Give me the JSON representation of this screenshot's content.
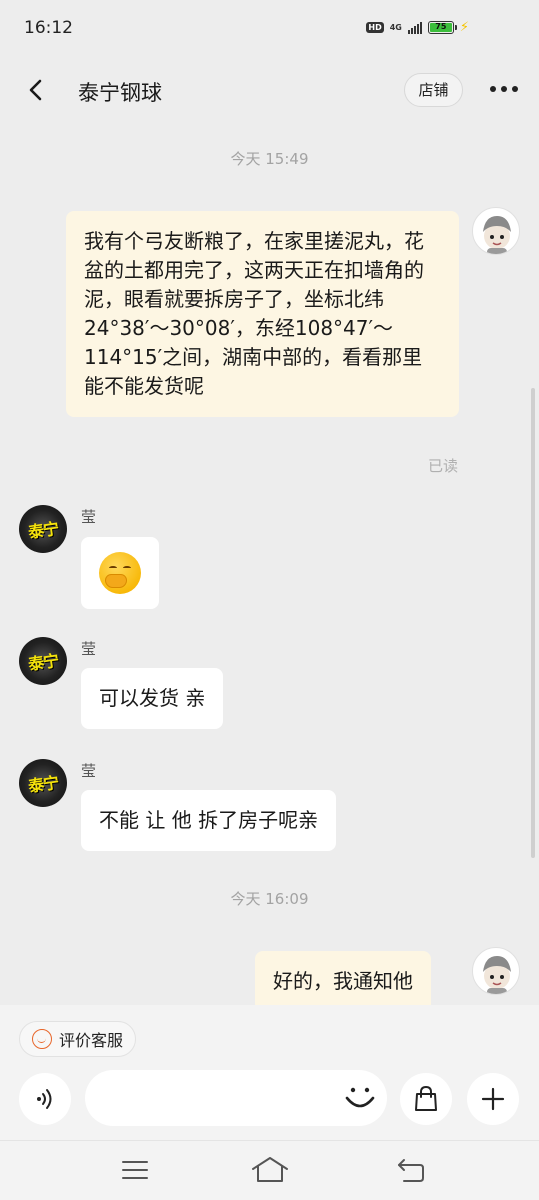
{
  "status_bar": {
    "time": "16:12",
    "hd_label": "HD",
    "network_label": "4G",
    "battery_level": "75"
  },
  "header": {
    "title": "泰宁钢球",
    "store_label": "店铺"
  },
  "messages": {
    "timestamp_1": "今天  15:49",
    "outgoing_1": "我有个弓友断粮了，在家里搓泥丸，花盆的土都用完了，这两天正在扣墙角的泥，眼看就要拆房子了，坐标北纬24°38′～30°08′，东经108°47′～114°15′之间，湖南中部的，看看那里能不能发货呢",
    "read_label": "已读",
    "sender_name": "莹",
    "shop_avatar_text": "泰宁",
    "incoming_emoji": "face-with-hand-over-mouth",
    "incoming_2": "可以发货 亲",
    "incoming_3": "不能 让 他 拆了房子呢亲",
    "timestamp_2": "今天  16:09",
    "outgoing_2": "好的，我通知他"
  },
  "bottom": {
    "rate_label": "评价客服",
    "input_value": "",
    "input_placeholder": ""
  },
  "colors": {
    "background": "#ededed",
    "outgoing_bubble": "#fdf6e3",
    "incoming_bubble": "#ffffff",
    "accent": "#e8662a"
  }
}
